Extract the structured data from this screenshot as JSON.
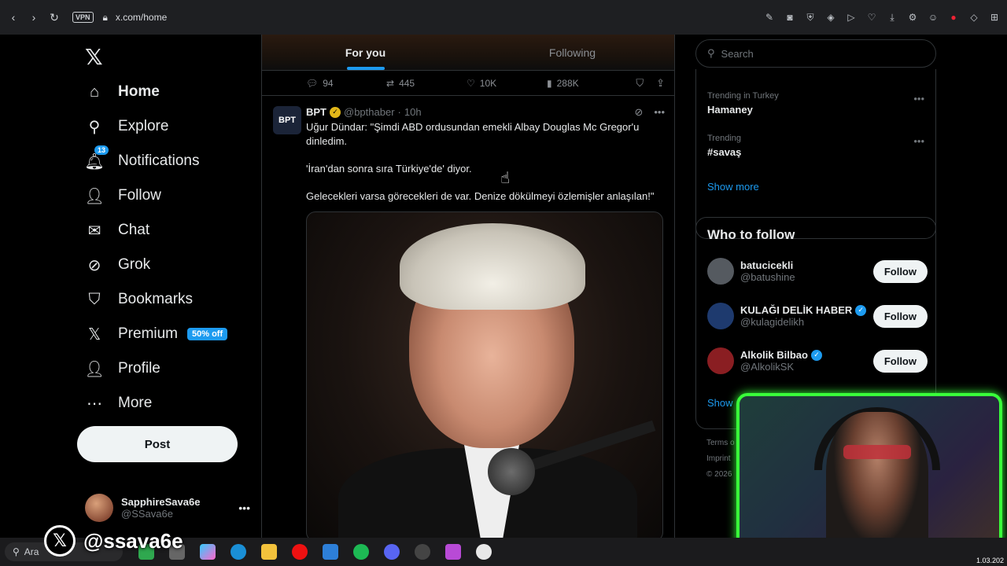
{
  "browser": {
    "url": "x.com/home",
    "vpn_label": "VPN"
  },
  "nav": {
    "items": [
      {
        "label": "Home",
        "icon": "home-icon"
      },
      {
        "label": "Explore",
        "icon": "search-icon"
      },
      {
        "label": "Notifications",
        "icon": "bell-icon",
        "badge": "13"
      },
      {
        "label": "Follow",
        "icon": "person-add-icon"
      },
      {
        "label": "Chat",
        "icon": "mail-icon"
      },
      {
        "label": "Grok",
        "icon": "grok-icon"
      },
      {
        "label": "Bookmarks",
        "icon": "bookmark-icon"
      },
      {
        "label": "Premium",
        "icon": "x-icon",
        "tag": "50% off"
      },
      {
        "label": "Profile",
        "icon": "person-icon"
      },
      {
        "label": "More",
        "icon": "more-circle-icon"
      }
    ],
    "post_label": "Post",
    "account": {
      "name": "SapphireSava6e",
      "handle": "@SSava6e"
    }
  },
  "feed": {
    "tabs": [
      "For you",
      "Following"
    ],
    "prev_actions": {
      "replies": "94",
      "reposts": "445",
      "likes": "10K",
      "views": "288K"
    },
    "tweet": {
      "avatar_text": "BPT",
      "name": "BPT",
      "handle": "@bpthaber",
      "time": "10h",
      "paragraphs": [
        "Uğur Dündar: \"Şimdi ABD ordusundan emekli Albay Douglas Mc Gregor'u dinledim.",
        "'İran'dan sonra sıra Türkiye'de' diyor.",
        "Gelecekleri varsa görecekleri de var. Denize dökülmeyi özlemişler anlaşılan!\""
      ]
    }
  },
  "right": {
    "search_placeholder": "Search",
    "trends": [
      {
        "meta": "Trending in Turkey",
        "name": "Hamaney"
      },
      {
        "meta": "Trending",
        "name": "#savaş"
      }
    ],
    "show_more": "Show more",
    "who_to_follow": {
      "title": "Who to follow",
      "users": [
        {
          "name": "batucicekli",
          "handle": "@batushine",
          "verified": false,
          "color": "#555a60"
        },
        {
          "name": "KULAĞI DELİK HABER",
          "handle": "@kulagidelikh",
          "verified": true,
          "color": "#1e3a6e"
        },
        {
          "name": "Alkolik Bilbao",
          "handle": "@AlkolikSK",
          "verified": true,
          "color": "#8a1e22"
        }
      ],
      "follow_label": "Follow",
      "show_label": "Show"
    },
    "footer": [
      "Terms o",
      "Imprint",
      "© 2026"
    ]
  },
  "taskbar": {
    "search_label": "Ara",
    "clock": "1.03.202"
  },
  "watermark": "@ssava6e",
  "colors": {
    "accent": "#1d9bf0",
    "webcam_frame": "#39ff3a"
  }
}
